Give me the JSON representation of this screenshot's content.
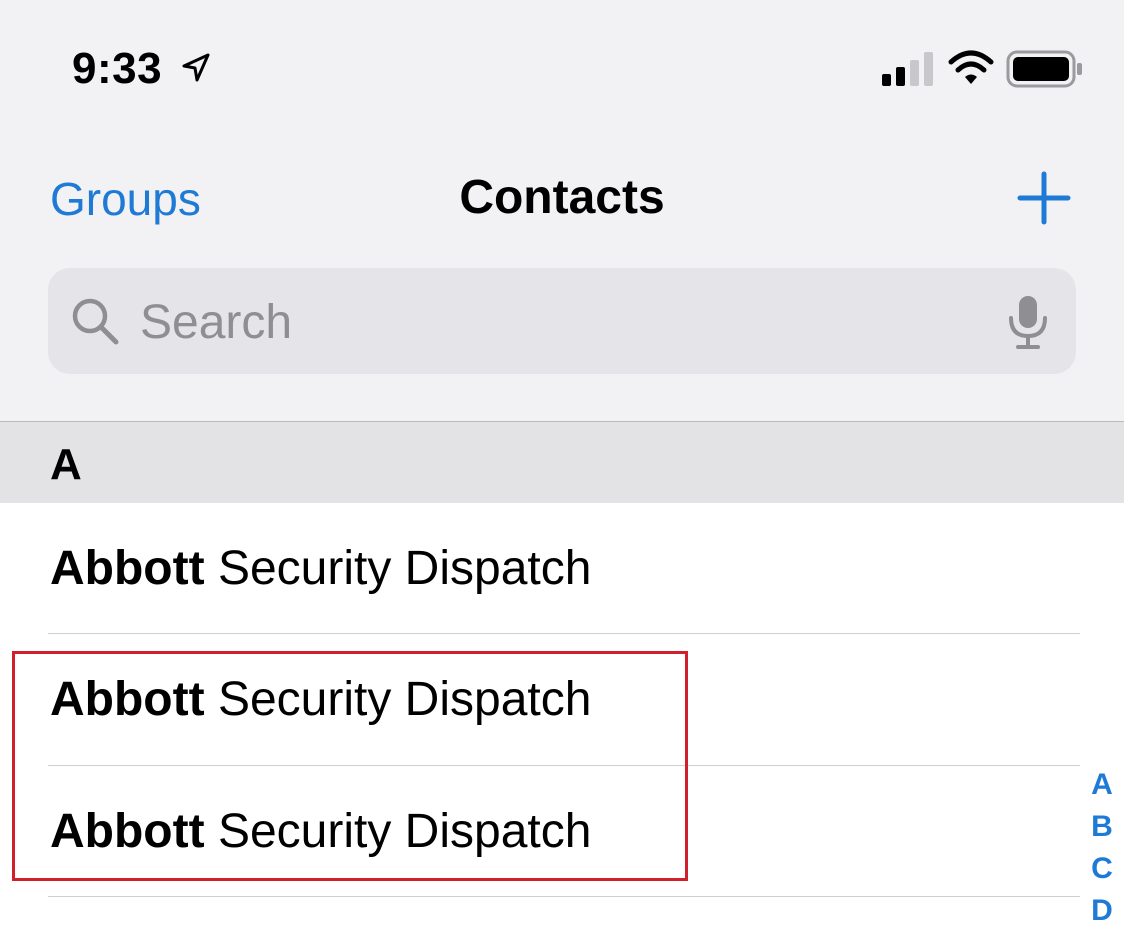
{
  "status_bar": {
    "time": "9:33",
    "icons": [
      "location-arrow-icon",
      "signal-icon",
      "wifi-icon",
      "battery-icon"
    ]
  },
  "nav": {
    "groups_label": "Groups",
    "title": "Contacts",
    "add_icon": "plus-icon"
  },
  "search": {
    "placeholder": "Search",
    "value": "",
    "icons": [
      "search-icon",
      "microphone-icon"
    ]
  },
  "list": {
    "section_letter": "A",
    "contacts": [
      {
        "last": "Abbott",
        "rest": "Security Dispatch"
      },
      {
        "last": "Abbott",
        "rest": "Security Dispatch"
      },
      {
        "last": "Abbott",
        "rest": "Security Dispatch"
      }
    ]
  },
  "index": [
    "A",
    "B",
    "C",
    "D"
  ],
  "colors": {
    "accent": "#1f7ad6",
    "highlight": "#d11f2b",
    "top_background": "#f2f2f4",
    "section_background": "#e3e3e6"
  }
}
